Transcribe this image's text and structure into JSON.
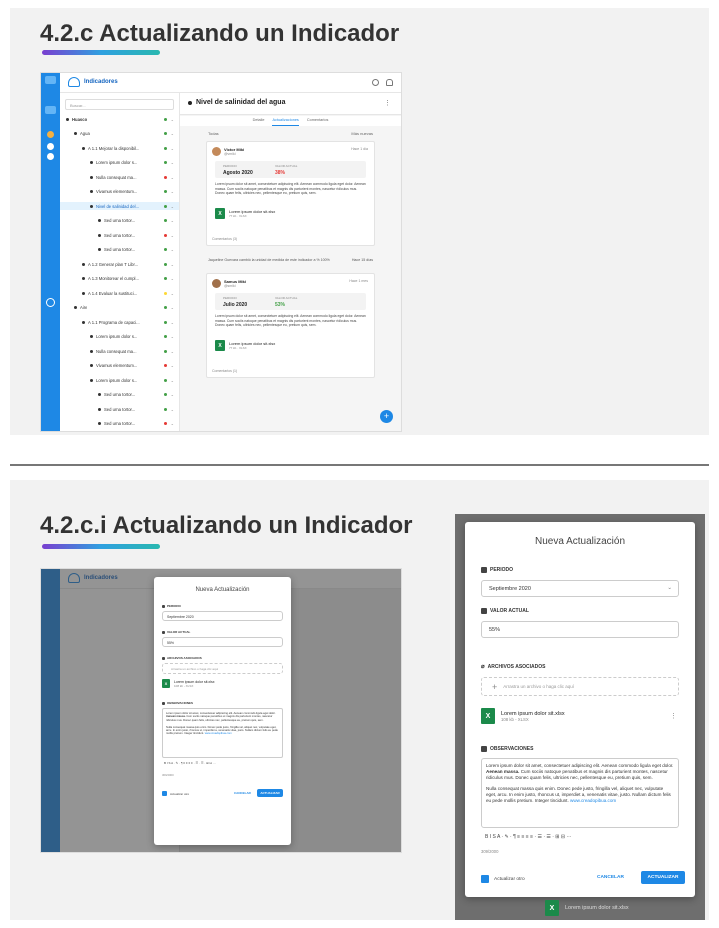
{
  "slide1": {
    "heading": "4.2.c Actualizando un Indicador",
    "app": {
      "brand": "Indicadores",
      "search_placeholder": "Buscar...",
      "tree": [
        {
          "label": "Huasco",
          "depth": 0,
          "status": "#43a047",
          "bold": true
        },
        {
          "label": "Agua",
          "depth": 1,
          "status": "#43a047"
        },
        {
          "label": "A 1.1 Mejorar la disponibil...",
          "depth": 2,
          "status": "#43a047"
        },
        {
          "label": "Lorem ipsum dolor s...",
          "depth": 3,
          "status": "#43a047"
        },
        {
          "label": "Nulla consequat ma...",
          "depth": 3,
          "status": "#e53935"
        },
        {
          "label": "Vivamus elementum...",
          "depth": 3,
          "status": "#43a047"
        },
        {
          "label": "Nivel de salinidad del...",
          "depth": 3,
          "status": "#43a047",
          "selected": true
        },
        {
          "label": "Sed urna tortor...",
          "depth": 4,
          "status": "#43a047"
        },
        {
          "label": "Sed urna tortor...",
          "depth": 4,
          "status": "#e53935"
        },
        {
          "label": "Sed urna tortor...",
          "depth": 4,
          "status": "#43a047"
        },
        {
          "label": "A 1.2 Generar plan T Libr...",
          "depth": 2,
          "status": "#43a047"
        },
        {
          "label": "A 1.3 Monitorear el cumpl...",
          "depth": 2,
          "status": "#43a047"
        },
        {
          "label": "A 1.4 Evaluar la sustituci...",
          "depth": 2,
          "status": "#fdd835"
        },
        {
          "label": "Aire",
          "depth": 1,
          "status": "#43a047"
        },
        {
          "label": "A 1.1 Programa de capaci...",
          "depth": 2,
          "status": "#43a047"
        },
        {
          "label": "Lorem ipsum dolor s...",
          "depth": 3,
          "status": "#43a047"
        },
        {
          "label": "Nulla consequat ma...",
          "depth": 3,
          "status": "#43a047"
        },
        {
          "label": "Vivamus elementum...",
          "depth": 3,
          "status": "#e53935"
        },
        {
          "label": "Lorem ipsum dolor s...",
          "depth": 3,
          "status": "#43a047"
        },
        {
          "label": "Sed urna tortor...",
          "depth": 4,
          "status": "#43a047"
        },
        {
          "label": "Sed urna tortor...",
          "depth": 4,
          "status": "#43a047"
        },
        {
          "label": "Sed urna tortor...",
          "depth": 4,
          "status": "#e53935"
        }
      ],
      "main_title": "Nivel de salinidad del agua",
      "tabs": [
        "Detalle",
        "Actualizaciones",
        "Comentarios"
      ],
      "filter_left": "Todas",
      "filter_right": "Más nuevas",
      "updates": [
        {
          "user": "Victor Miki",
          "role": "@vmiki",
          "time": "Hace 1 día",
          "period_label": "PERIODO",
          "period": "Agosto 2020",
          "value_label": "VALOR ACTUAL",
          "value": "38%",
          "value_color": "#e53935",
          "text": "Lorem ipsum dolor sit amet, consectetuer adipiscing elit. Aenean commodo ligula eget dolor. Aenean massa. Cum sociis natoque penatibus et magnis dis parturient montes, nascetur ridiculus mus. Donec quam felis, ultricies nec, pellentesque eu, pretium quis, sem.",
          "file": "Lorem ipsum dolor sit.xlsx",
          "file_size": "77 kb · XLSX",
          "comment": "Comentarios (3)"
        },
        {
          "user": "Samus Miki",
          "role": "@smiki",
          "time": "Hace 1 mes",
          "period_label": "PERIODO",
          "period": "Julio 2020",
          "value_label": "VALOR ACTUAL",
          "value": "53%",
          "value_color": "#43a047",
          "text": "Lorem ipsum dolor sit amet, consectetuer adipiscing elit. Aenean commodo ligula eget dolor. Aenean massa. Cum sociis natoque penatibus et magnis dis parturient montes, nascetur ridiculus mus. Donec quam felis, ultricies nec, pellentesque eu, pretium quis, sem.",
          "file": "Lorem ipsum dolor sit.xlsx",
          "file_size": "77 kb · XLSX",
          "comment": "Comentarios (1)"
        }
      ],
      "change_note": "Jaqueline Guevara cambió la unidad de medida de este indicador a % 100%",
      "change_time": "Hace 15 días",
      "fab": "+"
    }
  },
  "slide2": {
    "heading": "4.2.c.i Actualizando un Indicador",
    "modal": {
      "title": "Nueva Actualización",
      "periodo_label": "PERIODO",
      "periodo_value": "Septiembre 2020",
      "valor_label": "VALOR ACTUAL",
      "valor_value": "55%",
      "archivos_label": "ARCHIVOS ASOCIADOS",
      "drop_text": "Arrastra un archivo o haga clic aquí",
      "file_name": "Lorem ipsum dolor sit.xlsx",
      "file_size": "108 kb - XLSX",
      "obs_label": "OBSERVACIONES",
      "obs_p1a": "Lorem ipsum dolor sit amet, consectetuer adipiscing elit. Aenean commodo ligula eget dolor. ",
      "obs_p1b": "Aenean massa.",
      "obs_p1c": " Cum sociis natoque penatibus et magnis dis parturient montes, nascetur ridiculus mus. Donec quam felis, ultricies nec, pellentesque eu, pretium quis, sem.",
      "obs_p2a": "Nulla consequat massa quis enim. Donec pede justo, fringilla vel, aliquet nec, vulputate eget, arcu. In enim justo, rhoncus ut, imperdiet a, venenatis vitae, justo. Nullam dictum felis eu pede mollis pretium. Integer tincidunt. ",
      "obs_link": "www.creadopibua.com",
      "toolbar": "B  I  S  A  ·  ✎  ·  ¶  ≡  ≡  ≡  ≡  ·  ☰  ·  ☰  ·  ⊞  ⊟  ···",
      "counter": "309/2000",
      "checkbox": "Actualizar otro",
      "cancel": "CANCELAR",
      "submit": "ACTUALIZAR",
      "behind_file": "Lorem ipsum dolor sit.xlsx"
    }
  }
}
